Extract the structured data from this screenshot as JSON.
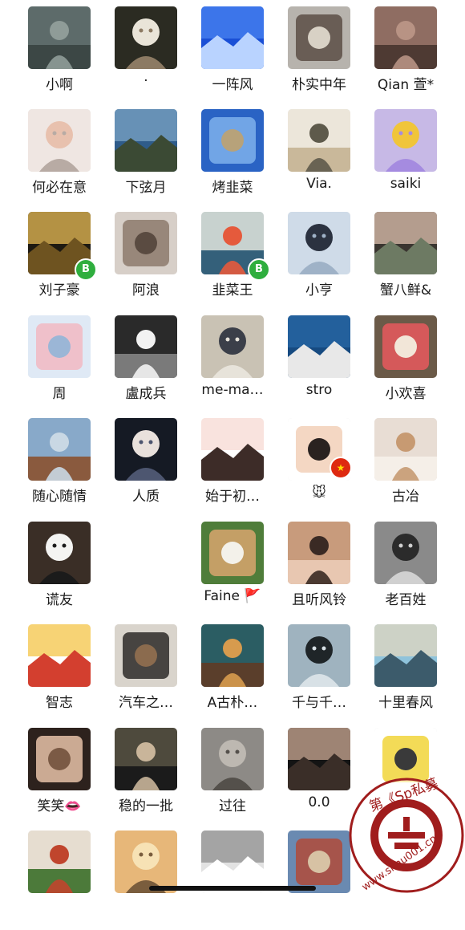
{
  "contacts": [
    {
      "name": "小啊",
      "icon": "person-in-rain-icon",
      "colors": [
        "#5d6b6a",
        "#8f9c98",
        "#3c4745"
      ]
    },
    {
      "name": "·",
      "icon": "girl-collage-icon",
      "colors": [
        "#2b2b22",
        "#e9e4d8",
        "#8c7a63"
      ]
    },
    {
      "name": "一阵风",
      "icon": "blue-cube-logo-icon",
      "colors": [
        "#1a4fd6",
        "#4c86f2",
        "#b9d3ff"
      ]
    },
    {
      "name": "朴实中年",
      "icon": "couple-at-sea-icon",
      "colors": [
        "#b7b3ad",
        "#5c4d45",
        "#d8d1c5"
      ]
    },
    {
      "name": "Qian 萱*",
      "icon": "canyon-person-icon",
      "colors": [
        "#8f6d62",
        "#b89384",
        "#4e3a33"
      ]
    },
    {
      "name": "何必在意",
      "icon": "baby-icon",
      "colors": [
        "#efe6e2",
        "#e8c1ae",
        "#b8aba4"
      ]
    },
    {
      "name": "下弦月",
      "icon": "man-by-lake-icon",
      "colors": [
        "#2f5c8a",
        "#7fa8c9",
        "#3b4a34"
      ]
    },
    {
      "name": "烤韭菜",
      "icon": "sky-landscape-icon",
      "colors": [
        "#2a63c4",
        "#7eb0ec",
        "#b7a27a"
      ]
    },
    {
      "name": "Via.",
      "icon": "sunburst-girl-icon",
      "colors": [
        "#ece6da",
        "#5e5a4b",
        "#c9b89a"
      ]
    },
    {
      "name": "saiki",
      "icon": "cartoon-cat-icon",
      "colors": [
        "#c7b9e6",
        "#f0c53a",
        "#a58be0"
      ]
    },
    {
      "name": "刘子豪",
      "icon": "sunset-icon",
      "colors": [
        "#1e1a12",
        "#f3c65a",
        "#6e5320"
      ],
      "badge": "bitcoin-badge-icon",
      "badge_text": "B"
    },
    {
      "name": "阿浪",
      "icon": "grumpy-cat-icon",
      "colors": [
        "#d7cfc8",
        "#8d7a6c",
        "#5a4b41"
      ]
    },
    {
      "name": "韭菜王",
      "icon": "abstract-face-icon",
      "colors": [
        "#c8d2cf",
        "#e55a3c",
        "#34607a"
      ],
      "badge": "bitcoin-badge-icon",
      "badge_text": "B"
    },
    {
      "name": "小亨",
      "icon": "standing-man-icon",
      "colors": [
        "#cfdbe8",
        "#2b3240",
        "#9fb2c7"
      ]
    },
    {
      "name": "蟹八鲜&",
      "icon": "woman-portrait-icon",
      "colors": [
        "#3a3530",
        "#e8cbb7",
        "#6d7a63"
      ]
    },
    {
      "name": "周",
      "icon": "piggy-snowman-icon",
      "colors": [
        "#dfe9f5",
        "#f2b8c2",
        "#9bb6d6"
      ]
    },
    {
      "name": "盧成兵",
      "icon": "bw-hand-icon",
      "colors": [
        "#2a2a2a",
        "#f2f2f2",
        "#7a7a7a"
      ]
    },
    {
      "name": "me-ma…",
      "icon": "striped-shirt-boy-icon",
      "colors": [
        "#c9c2b4",
        "#3b3f49",
        "#e7e3da"
      ]
    },
    {
      "name": "stro",
      "icon": "seagull-icon",
      "colors": [
        "#164a80",
        "#2a6aa8",
        "#e8e8e8"
      ]
    },
    {
      "name": "小欢喜",
      "icon": "strawberry-dessert-icon",
      "colors": [
        "#6b5a48",
        "#e8595e",
        "#f2e6d8"
      ]
    },
    {
      "name": "随心随情",
      "icon": "mountain-rock-icon",
      "colors": [
        "#88a9c9",
        "#c9d8e4",
        "#8a5a3e"
      ]
    },
    {
      "name": "人质",
      "icon": "anime-boy-icon",
      "colors": [
        "#151a24",
        "#e9e1dc",
        "#4d5670"
      ]
    },
    {
      "name": "始于初…",
      "icon": "bunny-girl-icon",
      "colors": [
        "#ffffff",
        "#f6d7d0",
        "#3d2c28"
      ]
    },
    {
      "name": "🐭",
      "icon": "cartoon-girl-icon",
      "colors": [
        "#ffffff",
        "#f2d0b8",
        "#2a2220"
      ],
      "badge": "china-flag-badge-icon",
      "badge_text": "★"
    },
    {
      "name": "古冶",
      "icon": "rabbit-icon",
      "colors": [
        "#e8ddd4",
        "#c79a72",
        "#f5efe8"
      ]
    },
    {
      "name": "谎友",
      "icon": "panda-icon",
      "colors": [
        "#3a2e26",
        "#f4f4f2",
        "#1b1b1b"
      ]
    },
    null,
    {
      "name": "Faine 🚩",
      "icon": "dog-icon",
      "colors": [
        "#4f7d3a",
        "#d8a56f",
        "#f3f1ea"
      ]
    },
    {
      "name": "且听风铃",
      "icon": "woman-glamour-icon",
      "colors": [
        "#c89b7c",
        "#3a2a24",
        "#e8c7b1"
      ]
    },
    {
      "name": "老百姓",
      "icon": "bw-man-portrait-icon",
      "colors": [
        "#8a8a8a",
        "#2b2b2b",
        "#d0d0d0"
      ]
    },
    {
      "name": "智志",
      "icon": "cartoon-god-icon",
      "colors": [
        "#ffffff",
        "#f4c03a",
        "#d33f2f"
      ]
    },
    {
      "name": "汽车之…",
      "icon": "office-man-icon",
      "colors": [
        "#d9d4cc",
        "#2d2a28",
        "#8b6b4e"
      ]
    },
    {
      "name": "A古朴…",
      "icon": "old-street-icon",
      "colors": [
        "#2b5d63",
        "#d79b4e",
        "#5a3e2b"
      ]
    },
    {
      "name": "千与千…",
      "icon": "man-coast-icon",
      "colors": [
        "#9fb3bf",
        "#1f2528",
        "#d8e1e6"
      ]
    },
    {
      "name": "十里春风",
      "icon": "beach-couple-icon",
      "colors": [
        "#8fc3db",
        "#e7d9bd",
        "#3c5b6b"
      ]
    },
    {
      "name": "笑笑👄",
      "icon": "smiling-woman-icon",
      "colors": [
        "#2d221d",
        "#e8c2a8",
        "#7b5a45"
      ]
    },
    {
      "name": "稳的一批",
      "icon": "movie-still-icon",
      "colors": [
        "#4e4a3d",
        "#c9b59a",
        "#1b1b1b"
      ]
    },
    {
      "name": "过往",
      "icon": "ruins-icon",
      "colors": [
        "#8d8a86",
        "#bdb8b1",
        "#54504b"
      ]
    },
    {
      "name": "0.0",
      "icon": "dark-baby-icon",
      "colors": [
        "#141414",
        "#d9b49d",
        "#3a2e28"
      ]
    },
    {
      "name": "",
      "icon": "yellow-bird-icon",
      "colors": [
        "#ffffff",
        "#f1d53a",
        "#3a3a3a"
      ]
    },
    {
      "name": "",
      "icon": "food-bowl-icon",
      "colors": [
        "#e6ddd0",
        "#c0452d",
        "#4c7a3a"
      ]
    },
    {
      "name": "",
      "icon": "road-traveler-icon",
      "colors": [
        "#e7b779",
        "#f7e2b5",
        "#7a5d3d"
      ]
    },
    {
      "name": "",
      "icon": "grey-cat-icon",
      "colors": [
        "#e2e2e2",
        "#8a8a8a",
        "#ffffff"
      ]
    },
    {
      "name": "",
      "icon": "kids-street-icon",
      "colors": [
        "#6a8ab1",
        "#b04a3a",
        "#d7c2a4"
      ]
    }
  ],
  "watermark": {
    "text": "第《Sp私募",
    "url_text": "www.simu001.cn",
    "color": "#9b1c1c"
  }
}
